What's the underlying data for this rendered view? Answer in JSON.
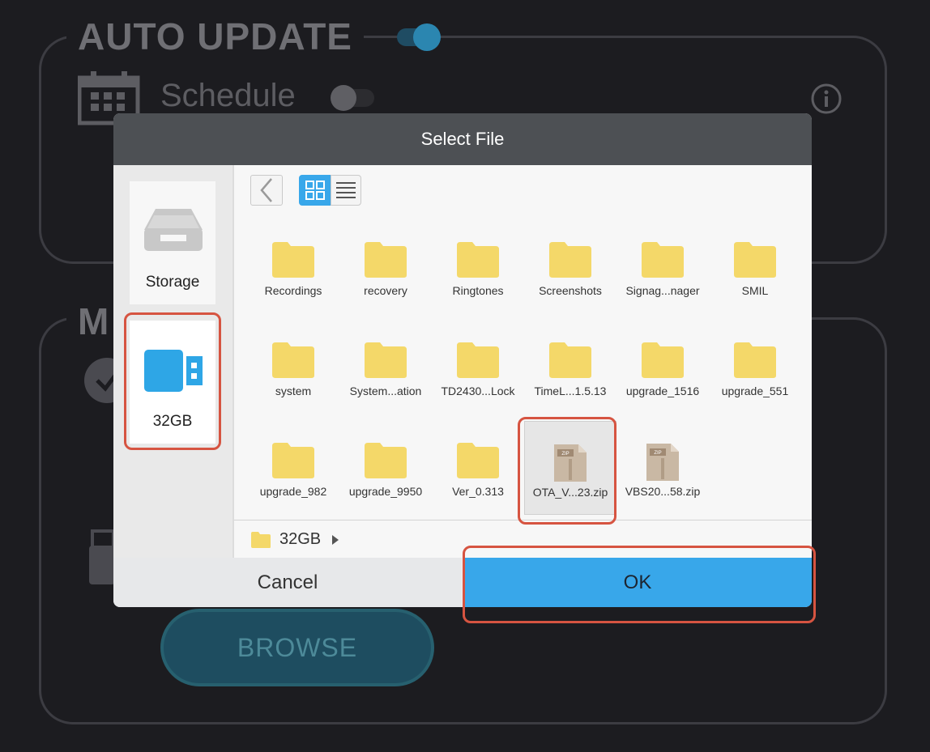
{
  "background": {
    "auto_update_title": "AUTO UPDATE",
    "schedule_label": "Schedule",
    "manual_title_partial": "M",
    "browse_label": "BROWSE"
  },
  "dialog": {
    "title": "Select File",
    "sidebar": [
      {
        "label": "Storage",
        "icon": "storage-tray-icon"
      },
      {
        "label": "32GB",
        "icon": "usb-drive-icon",
        "selected": true
      }
    ],
    "view_modes": [
      "grid-view-icon",
      "list-view-icon"
    ],
    "active_view": "grid",
    "items": [
      {
        "name": "Recordings",
        "type": "folder"
      },
      {
        "name": "recovery",
        "type": "folder"
      },
      {
        "name": "Ringtones",
        "type": "folder"
      },
      {
        "name": "Screenshots",
        "type": "folder"
      },
      {
        "name": "Signag...nager",
        "type": "folder"
      },
      {
        "name": "SMIL",
        "type": "folder"
      },
      {
        "name": "system",
        "type": "folder"
      },
      {
        "name": "System...ation",
        "type": "folder"
      },
      {
        "name": "TD2430...Lock",
        "type": "folder"
      },
      {
        "name": "TimeL...1.5.13",
        "type": "folder"
      },
      {
        "name": "upgrade_1516",
        "type": "folder"
      },
      {
        "name": "upgrade_551",
        "type": "folder"
      },
      {
        "name": "upgrade_982",
        "type": "folder"
      },
      {
        "name": "upgrade_9950",
        "type": "folder"
      },
      {
        "name": "Ver_0.313",
        "type": "folder"
      },
      {
        "name": "OTA_V...23.zip",
        "type": "zip",
        "selected": true
      },
      {
        "name": "VBS20...58.zip",
        "type": "zip"
      }
    ],
    "path": "32GB",
    "cancel_label": "Cancel",
    "ok_label": "OK"
  },
  "colors": {
    "ok_button": "#38a7ea",
    "highlight": "#d65441",
    "folder": "#f4d869",
    "usb": "#2ea6e6"
  }
}
